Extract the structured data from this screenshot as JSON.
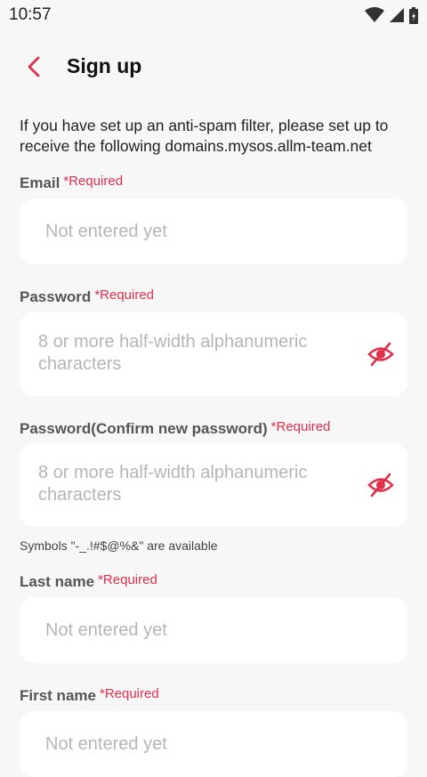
{
  "status": {
    "time": "10:57"
  },
  "header": {
    "title": "Sign up"
  },
  "notice": "If you have set up an anti-spam filter, please set up to receive the following domains.mysos.allm-team.net",
  "required_label": "*Required",
  "fields": {
    "email": {
      "label": "Email",
      "placeholder": "Not entered yet",
      "value": ""
    },
    "password": {
      "label": "Password",
      "placeholder": "8 or more half-width alphanumeric characters",
      "value": ""
    },
    "password_confirm": {
      "label": "Password(Confirm new password)",
      "placeholder": "8 or more half-width alphanumeric characters",
      "value": ""
    },
    "last_name": {
      "label": "Last name",
      "placeholder": "Not entered yet",
      "value": ""
    },
    "first_name": {
      "label": "First name",
      "placeholder": "Not entered yet",
      "value": ""
    }
  },
  "symbols_hint": "Symbols \"-_.!#$@%&\" are available",
  "colors": {
    "accent": "#e0304a",
    "background": "#f7f7f7",
    "field": "#ffffff"
  },
  "icons": [
    "back-chevron-icon",
    "eye-off-icon",
    "wifi-icon",
    "signal-icon",
    "battery-icon"
  ]
}
